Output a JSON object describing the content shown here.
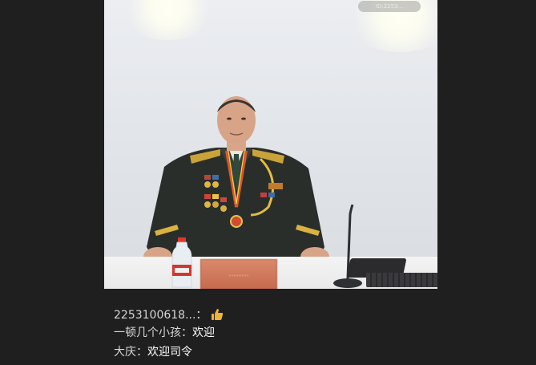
{
  "video": {
    "watermark": "ID:2253...",
    "nameplate_text": "........",
    "icons": {
      "bottle": "water-bottle",
      "microphone": "microphone"
    }
  },
  "chat": {
    "messages": [
      {
        "user": "",
        "text": ""
      },
      {
        "user": "2253100618...：",
        "text": "",
        "icon": "thumbs-up-icon"
      },
      {
        "user": "一顿几个小孩：",
        "text": "欢迎"
      },
      {
        "user": "大庆：",
        "text": "欢迎司令"
      },
      {
        "user": "",
        "text": ""
      }
    ]
  },
  "colors": {
    "background": "#1f1f1f",
    "wall": "#e3e6ea",
    "uniform": "#2a2e2b",
    "nameplate": "#c97556",
    "thumb": "#f2b233"
  }
}
